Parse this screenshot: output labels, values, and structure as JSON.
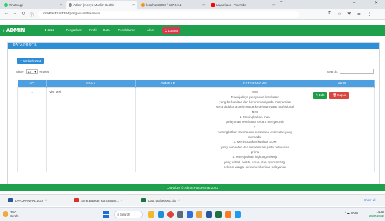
{
  "browser": {
    "tabs": [
      {
        "label": "WhatsApp",
        "color": "#25d366",
        "active": false
      },
      {
        "label": "Admin | Kenya Muslim Health",
        "color": "#888888",
        "active": true
      },
      {
        "label": "localhost:8080 / 127.0.0.1",
        "color": "#f29111",
        "active": false
      },
      {
        "label": "Layar kaca - YouTube",
        "color": "#ff0000",
        "active": false
      }
    ],
    "new_tab": "+",
    "window_controls": {
      "minimize": "–",
      "maximize": "□",
      "close": "✕"
    },
    "url_host": "localhost",
    "url_path": "/SISTEM/pengaduan/halaman",
    "toolbar_icons": [
      "key-icon",
      "star-icon",
      "extension-icon",
      "profile-icon",
      "menu-icon"
    ]
  },
  "navbar": {
    "brand": "ADMIN",
    "items": [
      "Home",
      "Pengaduan",
      "Profil",
      "Data",
      "Pendaftaran",
      "Akun"
    ],
    "logout": "Logout"
  },
  "panel": {
    "header": "DATA PROFIL",
    "add_button": "+ Tambah Data",
    "show_label": "Show",
    "show_value": "10",
    "entries_label": "entries",
    "search_label": "Search:",
    "columns": [
      "NO",
      "NAMA",
      "GAMBAR",
      "KETERANGAN",
      "AKSI"
    ],
    "rows": [
      {
        "no": "1",
        "nama": "Visi Misi",
        "gambar": "",
        "keterangan": [
          "VISI",
          "Terwujudnya pelayanan kesehatan",
          "yang berkualitas dan berorientasi pada masyarakat",
          "serta didukung oleh tenaga kesehatan yang profesional",
          "MISI",
          "1. Meningkatkan mutu",
          "pelayanan kesehatan secara menyeluruh",
          "2.",
          "Meningkatkan sarana dan prasarana kesehatan yang",
          "memadai",
          "3. Meningkatkan kualitas SDM",
          "yang kompeten dan berorientasi pada pelayanan",
          "prima",
          "4. Mewujudkan lingkungan kerja",
          "yang sehat, bersih, aman, dan nyaman bagi",
          "seluruh warga, serta memberikan pelayanan"
        ],
        "edit": "Edit",
        "delete": "Hapus"
      }
    ]
  },
  "footer": "Copyright © Admin Puskesmas 2022",
  "downloads": [
    {
      "name": "LAPORAN PKL.docx",
      "color": "#2b579a"
    },
    {
      "name": "Surat Balasan Rancangan...",
      "color": "#d93025"
    },
    {
      "name": "Data Mahasiswa.xlsx",
      "color": "#1e7145"
    }
  ],
  "downloads_show_all": "Show all",
  "taskbar": {
    "weather_temp": "29°C",
    "weather_desc": "Cerah",
    "search": "Search",
    "apps": [
      {
        "name": "file-explorer",
        "color": "#f3b72e"
      },
      {
        "name": "edge-browser",
        "color": "#1f8fd6"
      },
      {
        "name": "chrome-browser",
        "color": "#db4437"
      },
      {
        "name": "settings",
        "color": "#5b6b7a"
      },
      {
        "name": "store",
        "color": "#2f6fd6"
      },
      {
        "name": "mail",
        "color": "#e6a23c"
      },
      {
        "name": "word",
        "color": "#2b579a"
      },
      {
        "name": "excel",
        "color": "#1e7145"
      },
      {
        "name": "xampp",
        "color": "#fb7a24"
      },
      {
        "name": "vscode",
        "color": "#1f9cf0"
      }
    ],
    "tray": "^  ☁  ENG",
    "time": "14:25",
    "date": "20/07/2022"
  }
}
